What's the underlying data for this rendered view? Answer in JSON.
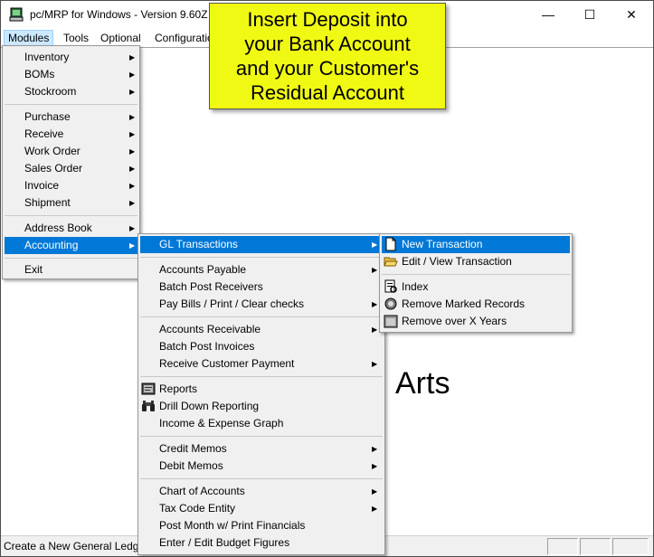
{
  "window": {
    "title": "pc/MRP for Windows - Version 9.60Z",
    "minimize": "—",
    "maximize": "☐",
    "close": "✕"
  },
  "menubar": [
    "Modules",
    "Tools",
    "Optional",
    "Configuratio"
  ],
  "callout": "Insert Deposit into\nyour Bank Account\nand your Customer's\nResidual Account",
  "logo_text": "Arts",
  "status": {
    "text": "Create a New General Ledger tr"
  },
  "modules_menu": [
    "Inventory",
    "BOMs",
    "Stockroom",
    "Purchase",
    "Receive",
    "Work Order",
    "Sales Order",
    "Invoice",
    "Shipment",
    "Address Book",
    "Accounting",
    "Exit"
  ],
  "accounting_menu": [
    "GL Transactions",
    "Accounts Payable",
    "Batch Post Receivers",
    "Pay Bills / Print / Clear checks",
    "Accounts Receivable",
    "Batch Post Invoices",
    "Receive Customer Payment",
    "Reports",
    "Drill Down Reporting",
    "Income & Expense Graph",
    "Credit Memos",
    "Debit Memos",
    "Chart of Accounts",
    "Tax Code Entity",
    "Post Month w/ Print Financials",
    "Enter / Edit Budget Figures"
  ],
  "gl_menu": [
    "New Transaction",
    "Edit / View Transaction",
    "Index",
    "Remove Marked Records",
    "Remove over X Years"
  ],
  "colors": {
    "highlight": "#0078d7",
    "callout": "#f0f914",
    "menu_bg": "#f0f0f0"
  }
}
